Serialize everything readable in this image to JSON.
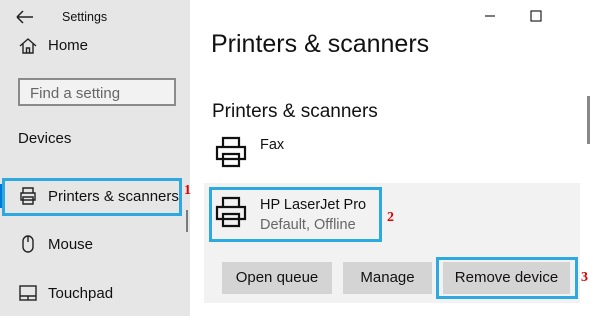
{
  "window": {
    "title": "Settings"
  },
  "sidebar": {
    "home_label": "Home",
    "search": {
      "placeholder": "Find a setting"
    },
    "section_heading": "Devices",
    "items": [
      {
        "label": "Printers & scanners",
        "icon": "printer-icon",
        "selected": true
      },
      {
        "label": "Mouse",
        "icon": "mouse-icon",
        "selected": false
      },
      {
        "label": "Touchpad",
        "icon": "touchpad-icon",
        "selected": false
      }
    ]
  },
  "main": {
    "page_title": "Printers & scanners",
    "section_title": "Printers & scanners",
    "devices": [
      {
        "name": "Fax",
        "status": ""
      },
      {
        "name": "HP LaserJet Pro",
        "status": "Default, Offline"
      }
    ],
    "actions": {
      "open_queue": "Open queue",
      "manage": "Manage",
      "remove_device": "Remove device"
    }
  },
  "annotations": {
    "step1": "1",
    "step2": "2",
    "step3": "3"
  },
  "colors": {
    "accent": "#0078d7",
    "highlight": "#2ca9e1",
    "badge": "#e00000",
    "sidebar_bg": "#e6e6e6",
    "button_bg": "#d4d4d4"
  }
}
